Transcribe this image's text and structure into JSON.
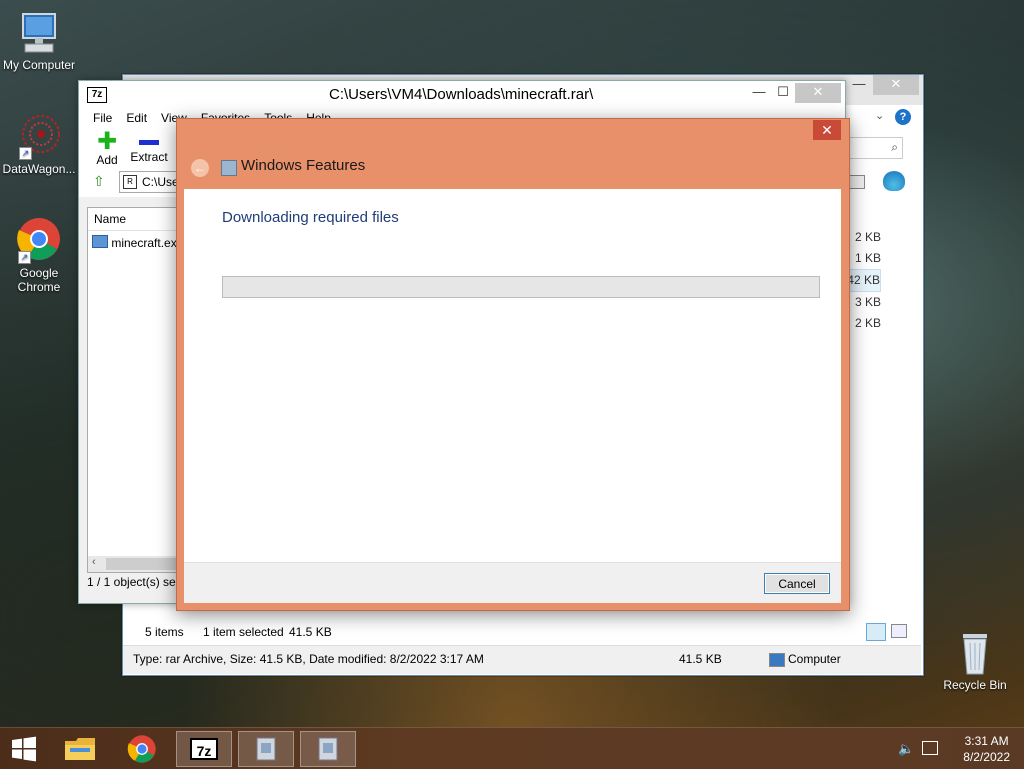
{
  "desktop": {
    "icons": [
      {
        "label": "My Computer"
      },
      {
        "label": "DataWagon..."
      },
      {
        "label": "Google Chrome"
      },
      {
        "label": "Recycle Bin"
      }
    ]
  },
  "explorer": {
    "sizes": [
      "2 KB",
      "1 KB",
      "42 KB",
      "3 KB",
      "2 KB"
    ],
    "items_count": "5 items",
    "selected": "1 item selected",
    "selected_size": "41.5 KB",
    "details": "Type: rar Archive, Size: 41.5 KB, Date modified: 8/2/2022 3:17 AM",
    "details_size": "41.5 KB",
    "location": "Computer"
  },
  "zip": {
    "logo": "7z",
    "title": "C:\\Users\\VM4\\Downloads\\minecraft.rar\\",
    "menu": [
      "File",
      "Edit",
      "View",
      "Favorites",
      "Tools",
      "Help"
    ],
    "toolbar": {
      "add": "Add",
      "extract": "Extract"
    },
    "address": "C:\\Use",
    "column_name": "Name",
    "file": "minecraft.ex",
    "status": "1 / 1 object(s) sel"
  },
  "dialog": {
    "title": "Windows Features",
    "heading": "Downloading required files",
    "progress": 0,
    "cancel": "Cancel"
  },
  "taskbar": {
    "time": "3:31 AM",
    "date": "8/2/2022",
    "zip_label": "7z"
  },
  "colors": {
    "dialog_frame": "#e8906a",
    "heading_text": "#1e3d78",
    "taskbar": "#5e3a22"
  }
}
